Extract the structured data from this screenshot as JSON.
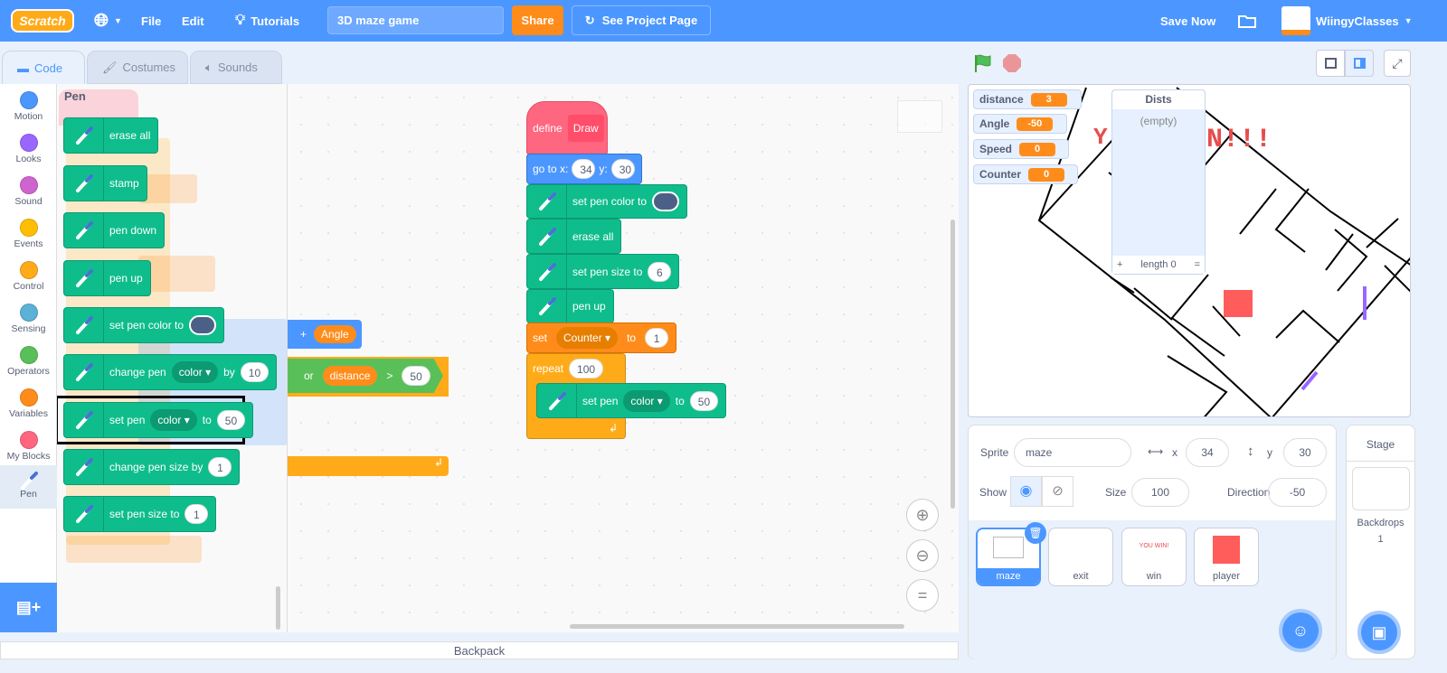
{
  "menubar": {
    "logo": "Scratch",
    "file": "File",
    "edit": "Edit",
    "tutorials": "Tutorials",
    "project_title": "3D maze game",
    "share": "Share",
    "see_project": "See Project Page",
    "save_now": "Save Now",
    "username": "WiingyClasses"
  },
  "tabs": [
    {
      "label": "Code"
    },
    {
      "label": "Costumes"
    },
    {
      "label": "Sounds"
    }
  ],
  "categories": [
    {
      "label": "Motion",
      "color": "#4c97ff"
    },
    {
      "label": "Looks",
      "color": "#9966ff"
    },
    {
      "label": "Sound",
      "color": "#cf63cf"
    },
    {
      "label": "Events",
      "color": "#ffbf00"
    },
    {
      "label": "Control",
      "color": "#ffab19"
    },
    {
      "label": "Sensing",
      "color": "#5cb1d6"
    },
    {
      "label": "Operators",
      "color": "#59c059"
    },
    {
      "label": "Variables",
      "color": "#ff8c1a"
    },
    {
      "label": "My Blocks",
      "color": "#ff6680"
    },
    {
      "label": "Pen",
      "color": "#0fbd8c"
    }
  ],
  "palette": {
    "heading": "Pen",
    "blocks": {
      "erase_all": "erase all",
      "stamp": "stamp",
      "pen_down": "pen down",
      "pen_up": "pen up",
      "set_pen_color": "set pen color to",
      "change_pen": "change pen",
      "change_pen_param": "color",
      "change_by": "by",
      "change_value": "10",
      "set_pen": "set pen",
      "set_pen_param": "color",
      "set_to": "to",
      "set_value": "50",
      "change_size": "change pen size by",
      "change_size_value": "1",
      "set_size": "set pen size to",
      "set_size_value": "1"
    }
  },
  "workspace": {
    "background_blocks": {
      "plus": "+",
      "angle": "Angle",
      "or": "or",
      "distance": "distance",
      "gt": ">",
      "value": "50"
    },
    "script": {
      "define": "define",
      "define_name": "Draw",
      "goto": "go to x:",
      "goto_x": "34",
      "goto_y_label": "y:",
      "goto_y": "30",
      "set_pen_color": "set pen color to",
      "erase_all": "erase all",
      "set_size": "set pen size to",
      "set_size_value": "6",
      "pen_up": "pen up",
      "set": "set",
      "set_var": "Counter",
      "set_to": "to",
      "set_value": "1",
      "repeat": "repeat",
      "repeat_value": "100",
      "inner_set_pen": "set pen",
      "inner_param": "color",
      "inner_to": "to",
      "inner_value": "50"
    }
  },
  "backpack": "Backpack",
  "stage": {
    "monitors": [
      {
        "label": "distance",
        "value": "3"
      },
      {
        "label": "Angle",
        "value": "-50"
      },
      {
        "label": "Speed",
        "value": "0"
      },
      {
        "label": "Counter",
        "value": "0"
      }
    ],
    "list": {
      "title": "Dists",
      "empty": "(empty)",
      "add": "+",
      "length": "length 0",
      "resize": "="
    }
  },
  "sprite_info": {
    "sprite_label": "Sprite",
    "sprite_name": "maze",
    "x_label": "x",
    "x": "34",
    "y_label": "y",
    "y": "30",
    "show_label": "Show",
    "size_label": "Size",
    "size": "100",
    "direction_label": "Direction",
    "direction": "-50"
  },
  "sprites": [
    {
      "name": "maze",
      "selected": true
    },
    {
      "name": "exit"
    },
    {
      "name": "win",
      "thumb_text": "YOU WIN!"
    },
    {
      "name": "player"
    }
  ],
  "stage_pane": {
    "title": "Stage",
    "backdrops_label": "Backdrops",
    "backdrops_count": "1"
  },
  "colors": {
    "menubar": "#4c97ff",
    "pen": "#0fbd8c",
    "motion": "#4c97ff",
    "variables": "#ff8c1a",
    "control": "#ffab19",
    "myblocks": "#ff6680"
  }
}
